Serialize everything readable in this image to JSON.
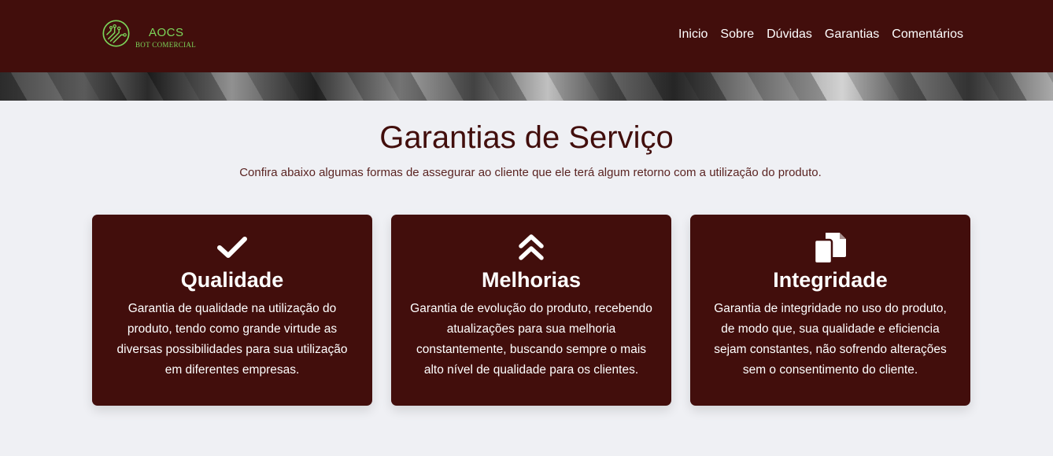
{
  "brand": {
    "name": "AOCS",
    "tagline": "BOT COMERCIAL"
  },
  "nav": {
    "items": [
      "Inicio",
      "Sobre",
      "Dúvidas",
      "Garantias",
      "Comentários"
    ]
  },
  "section": {
    "title": "Garantias de Serviço",
    "subtitle": "Confira abaixo algumas formas de assegurar ao cliente que ele terá algum retorno com a utilização do produto."
  },
  "cards": [
    {
      "icon": "check-icon",
      "title": "Qualidade",
      "text": "Garantia de qualidade na utilização do produto, tendo como grande virtude as diversas possibilidades para sua utilização em diferentes empresas."
    },
    {
      "icon": "double-chevron-up-icon",
      "title": "Melhorias",
      "text": "Garantia de evolução do produto, recebendo atualizações para sua melhoria constantemente, buscando sempre o mais alto nível de qualidade para os clientes."
    },
    {
      "icon": "copy-icon",
      "title": "Integridade",
      "text": "Garantia de integridade no uso do produto, de modo que, sua qualidade e eficiencia sejam constantes, não sofrendo alterações sem o consentimento do cliente."
    }
  ],
  "colors": {
    "header_bg": "#420e0c",
    "accent_green": "#7cd65a",
    "page_bg": "#eff0f4"
  }
}
